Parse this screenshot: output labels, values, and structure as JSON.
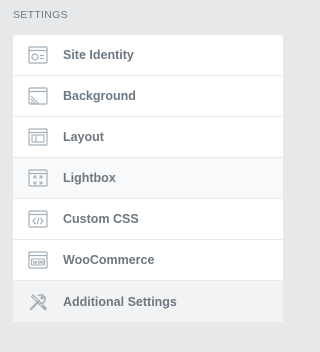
{
  "section": {
    "title": "SETTINGS"
  },
  "menu": {
    "items": [
      {
        "label": "Site Identity",
        "icon": "site-identity-icon"
      },
      {
        "label": "Background",
        "icon": "background-icon"
      },
      {
        "label": "Layout",
        "icon": "layout-icon"
      },
      {
        "label": "Lightbox",
        "icon": "lightbox-icon"
      },
      {
        "label": "Custom CSS",
        "icon": "custom-css-icon"
      },
      {
        "label": "WooCommerce",
        "icon": "woocommerce-icon"
      },
      {
        "label": "Additional Settings",
        "icon": "additional-settings-icon"
      }
    ]
  },
  "colors": {
    "page_background": "#e6e8ea",
    "panel_background": "#ffffff",
    "text": "#6d7882",
    "icon": "#a4afb7"
  }
}
